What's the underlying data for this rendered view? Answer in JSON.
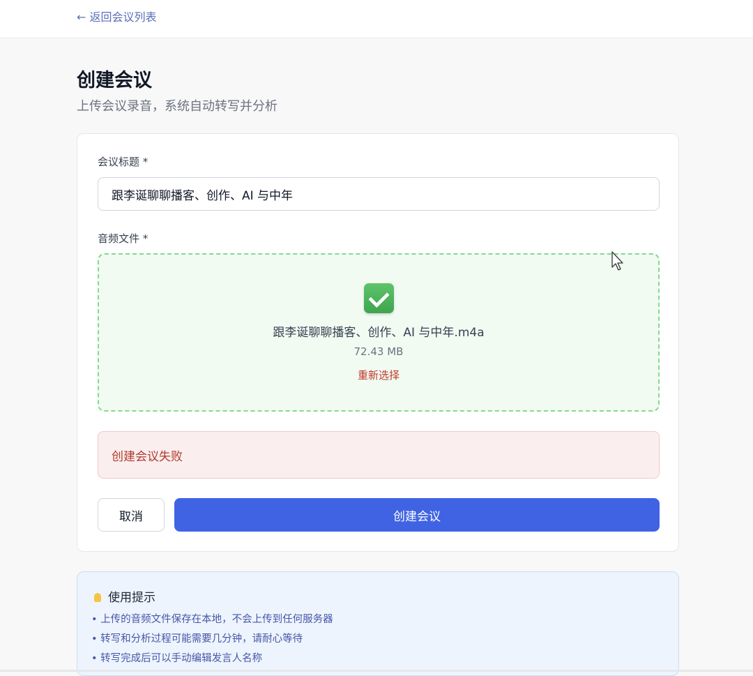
{
  "nav": {
    "back_label": "← 返回会议列表"
  },
  "header": {
    "title": "创建会议",
    "subtitle": "上传会议录音，系统自动转写并分析"
  },
  "form": {
    "title_label": "会议标题 *",
    "title_value": "跟李诞聊聊播客、创作、AI 与中年",
    "audio_label": "音频文件 *",
    "file": {
      "status_icon": "check-mark-icon",
      "name": "跟李诞聊聊播客、创作、AI 与中年.m4a",
      "size": "72.43 MB",
      "reselect_label": "重新选择"
    },
    "error_message": "创建会议失败",
    "cancel_label": "取消",
    "submit_label": "创建会议"
  },
  "tips": {
    "title": "使用提示",
    "items": [
      "上传的音频文件保存在本地，不会上传到任何服务器",
      "转写和分析过程可能需要几分钟，请耐心等待",
      "转写完成后可以手动编辑发言人名称"
    ]
  },
  "colors": {
    "primary": "#3f63e3",
    "success_border": "#86d98f",
    "error_text": "#b03a2e",
    "link": "#5b6fb7"
  }
}
